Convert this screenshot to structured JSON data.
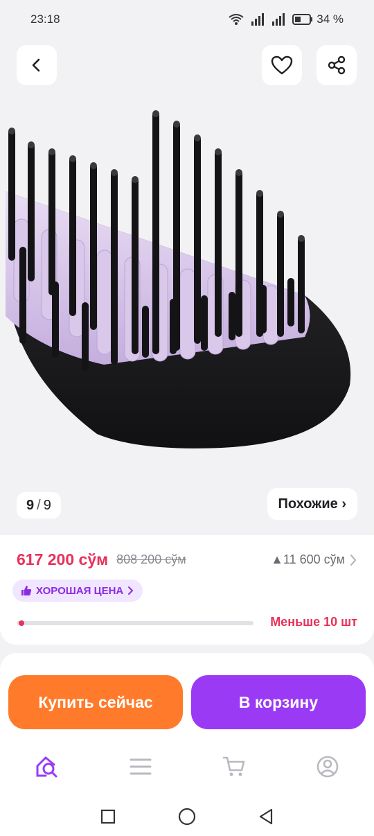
{
  "status": {
    "time": "23:18",
    "battery": "34 %"
  },
  "gallery": {
    "current": "9",
    "total": "9",
    "similar_label": "Похожие ›"
  },
  "price": {
    "current": "617 200 сўм",
    "old": "808 200 сўм",
    "delta": "▲11 600 сўм",
    "badge": "ХОРОШАЯ ЦЕНА",
    "stock_text": "Меньше 10 шт",
    "stock_level": 0.02
  },
  "actions": {
    "buy_now": "Купить сейчас",
    "add_to_cart": "В корзину"
  },
  "colors": {
    "accent_red": "#e8315a",
    "buy_orange": "#ff7a2b",
    "cart_purple": "#9b3af5",
    "nav_active": "#9b3af5"
  },
  "nav": {
    "items": [
      "home-search-icon",
      "catalog-icon",
      "cart-icon",
      "profile-icon"
    ]
  }
}
